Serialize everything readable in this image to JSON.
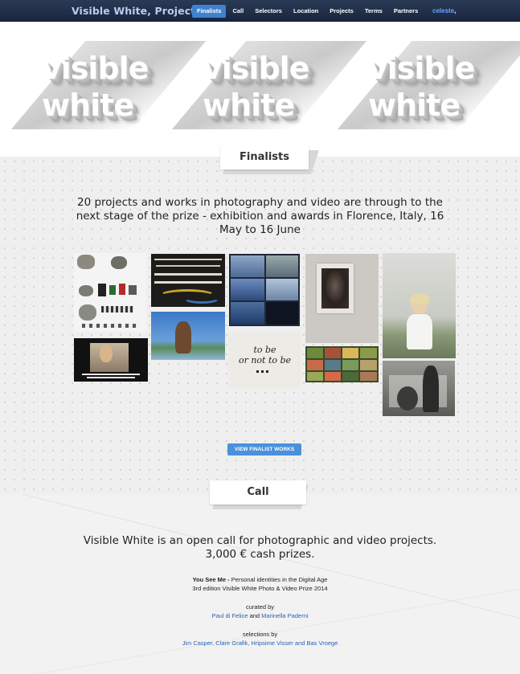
{
  "nav": {
    "brand": "Visible White, Projects",
    "items": [
      "Finalists",
      "Call",
      "Selectors",
      "Location",
      "Projects",
      "Terms",
      "Partners"
    ],
    "active": "Finalists",
    "user": "celeste",
    "user_suffix": ","
  },
  "hero": {
    "logo_line1": "visible",
    "logo_line2": "white"
  },
  "finalists": {
    "tab_label": "Finalists",
    "lead": "20 projects and works in photography and video are through to the next stage of the prize - exhibition and awards in Florence, Italy, 16 May to 16 June",
    "button": "VIEW FINALIST WORKS",
    "thumb_text": {
      "to_be": "to be",
      "or_not": "or not to be"
    }
  },
  "call": {
    "tab_label": "Call",
    "lead1": "Visible White is an open call for photographic and video projects.",
    "lead2": "3,000 € cash prizes.",
    "title_bold": "You See Me -",
    "title_rest": " Personal identities in the Digital Age",
    "edition": "3rd edition Visible White Photo & Video Prize 2014",
    "curated_by": "curated by",
    "curator1": "Paul di Felice",
    "and": "and",
    "curator2": "Marinella Paderni",
    "selections_by": "selections by",
    "selectors": "Jim Casper, Clare Grafik, Hripsime Visser and Bas Vroege"
  },
  "colors": {
    "nav_bg": "#1f2c47",
    "brand": "#b7cdf0",
    "accent": "#3f82cf",
    "link": "#2a62b5"
  }
}
